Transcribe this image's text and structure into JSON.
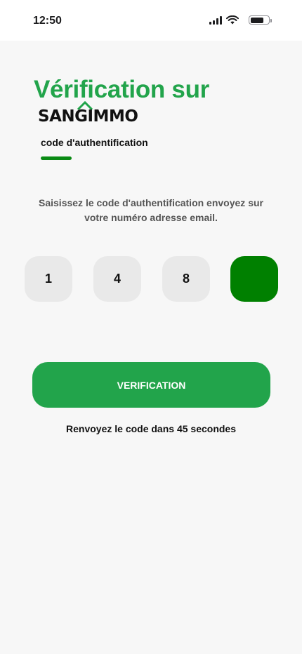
{
  "status_bar": {
    "time": "12:50"
  },
  "header": {
    "title": "Vérification sur",
    "logo_text": "SANGIMMO",
    "subtitle": "code d'authentification"
  },
  "instructions": "Saisissez le code d'authentification envoyez sur votre numéro adresse email.",
  "code": {
    "digits": [
      "1",
      "4",
      "8",
      ""
    ],
    "active_index": 3
  },
  "verify_button": {
    "label": "VERIFICATION"
  },
  "resend_text": "Renvoyez le code dans 45 secondes",
  "colors": {
    "primary_green": "#22a44b",
    "dark_green": "#008000",
    "box_gray": "#e9e9e9",
    "background": "#f7f7f7"
  }
}
